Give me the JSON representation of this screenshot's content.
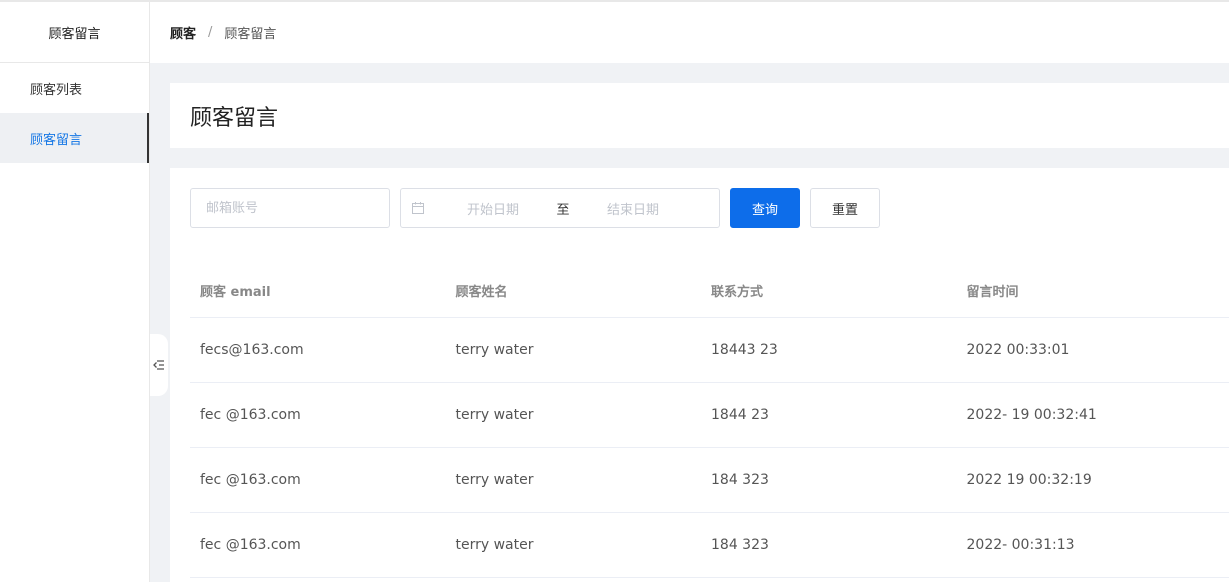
{
  "sidebar": {
    "brand": "顾客留言",
    "items": [
      {
        "label": "顾客列表",
        "active": false
      },
      {
        "label": "顾客留言",
        "active": true
      }
    ]
  },
  "header": {
    "breadcrumb_root": "顾客",
    "breadcrumb_sep": "/",
    "breadcrumb_current": "顾客留言"
  },
  "page": {
    "title": "顾客留言"
  },
  "filters": {
    "email_placeholder": "邮箱账号",
    "start_placeholder": "开始日期",
    "range_sep": "至",
    "end_placeholder": "结束日期",
    "query_label": "查询",
    "reset_label": "重置"
  },
  "table": {
    "columns": [
      "顾客 email",
      "顾客姓名",
      "联系方式",
      "留言时间"
    ],
    "rows": [
      [
        "fecs@163.com",
        "terry water",
        "18443 23",
        "2022 00:33:01"
      ],
      [
        "fec @163.com",
        "terry water",
        "1844 23",
        "2022- 19 00:32:41"
      ],
      [
        "fec @163.com",
        "terry water",
        "184 323",
        "2022 19 00:32:19"
      ],
      [
        "fec @163.com",
        "terry water",
        "184 323",
        "2022- 00:31:13"
      ]
    ]
  },
  "icons": {
    "calendar": "calendar-icon",
    "collapse": "collapse-left-icon"
  },
  "colors": {
    "primary": "#0d6dea",
    "active_text": "#1677e5"
  }
}
